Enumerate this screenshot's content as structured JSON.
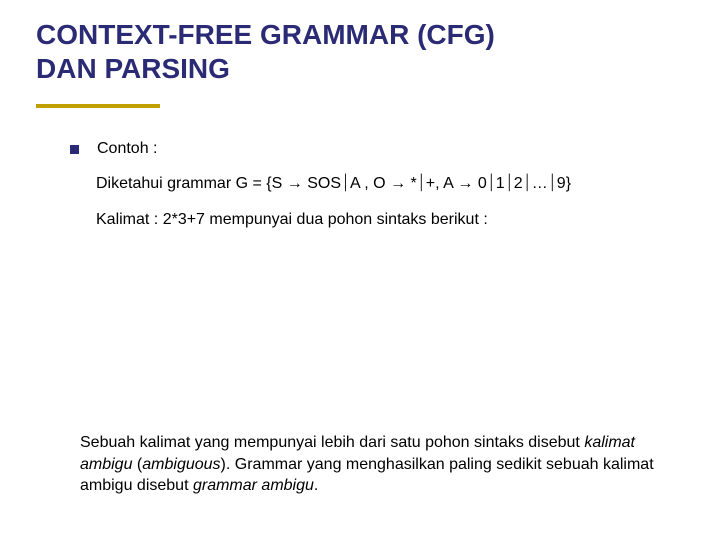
{
  "title": {
    "line1": "CONTEXT-FREE GRAMMAR (CFG)",
    "line2": "DAN PARSING"
  },
  "body": {
    "bullet_label": "Contoh :",
    "grammar_prefix": "Diketahui grammar G = {S ",
    "arrow": "→",
    "bar": "⏐",
    "g_sos": " SOS",
    "g_a": "A ,  O ",
    "g_star": " *",
    "g_plus": "+, A ",
    "g_0": " 0",
    "g_1": "1",
    "g_2": "2",
    "g_dots": "…",
    "g_9": "9}",
    "kalimat": "Kalimat : 2*3+7 mempunyai dua pohon sintaks berikut  :"
  },
  "footer": {
    "p1a": "Sebuah kalimat yang mempunyai lebih dari satu pohon sintaks disebut ",
    "p1b": "kalimat ambigu",
    "p1c": " (",
    "p1d": "ambiguous",
    "p1e": "). Grammar yang menghasilkan paling sedikit sebuah kalimat ambigu disebut ",
    "p1f": "grammar ambigu",
    "p1g": "."
  }
}
